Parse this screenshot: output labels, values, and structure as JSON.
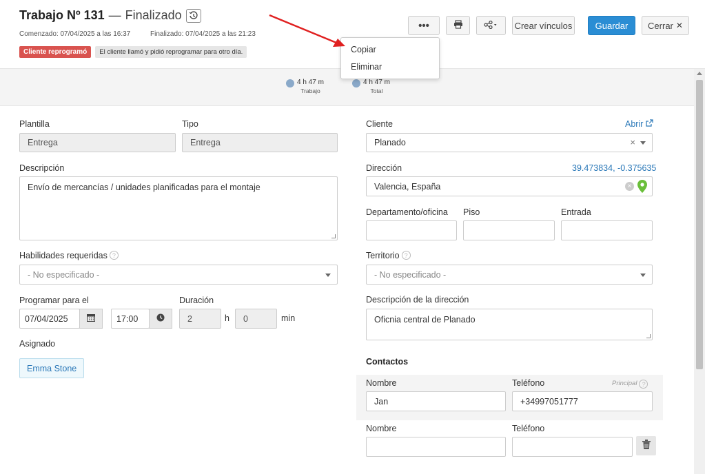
{
  "header": {
    "job_title": "Trabajo Nº 131",
    "separator": "—",
    "status": "Finalizado",
    "started": "Comenzado: 07/04/2025 a las 16:37",
    "finished": "Finalizado: 07/04/2025 a las 21:23",
    "tag_label": "Cliente reprogramó",
    "tag_note": "El cliente llamó y pidió reprogramar para otro día."
  },
  "toolbar": {
    "more_label": "•••",
    "create_links_label": "Crear vínculos",
    "save_label": "Guardar",
    "close_label": "Cerrar",
    "close_glyph": "✕"
  },
  "dropdown_menu": {
    "items": [
      "Copiar",
      "Eliminar"
    ]
  },
  "timers": {
    "work": {
      "value": "4 h 47 m",
      "label": "Trabajo"
    },
    "total": {
      "value": "4 h 47 m",
      "label": "Total"
    }
  },
  "form": {
    "template": {
      "label": "Plantilla",
      "value": "Entrega"
    },
    "type": {
      "label": "Tipo",
      "value": "Entrega"
    },
    "description": {
      "label": "Descripción",
      "value": "Envío de mercancías / unidades planificadas para el montaje"
    },
    "skills": {
      "label": "Habilidades requeridas",
      "value": "- No especificado -"
    },
    "schedule": {
      "label": "Programar para el",
      "date": "07/04/2025",
      "time": "17:00"
    },
    "duration": {
      "label": "Duración",
      "hours": "2",
      "hours_unit": "h",
      "minutes": "0",
      "minutes_unit": "min"
    },
    "assigned": {
      "label": "Asignado",
      "value": "Emma Stone"
    },
    "client": {
      "label": "Cliente",
      "open_link": "Abrir",
      "value": "Planado",
      "clear_glyph": "×"
    },
    "address": {
      "label": "Dirección",
      "coords": "39.473834, -0.375635",
      "value": "Valencia, España"
    },
    "department": {
      "label": "Departamento/oficina",
      "value": ""
    },
    "floor": {
      "label": "Piso",
      "value": ""
    },
    "entrance": {
      "label": "Entrada",
      "value": ""
    },
    "territory": {
      "label": "Territorio",
      "value": "- No especificado -"
    },
    "address_description": {
      "label": "Descripción de la dirección",
      "value": "Oficnia central de Planado"
    }
  },
  "contacts": {
    "title": "Contactos",
    "principal_label": "Principal",
    "rows": [
      {
        "name_label": "Nombre",
        "phone_label": "Teléfono",
        "name": "Jan",
        "phone": "+34997051777"
      },
      {
        "name_label": "Nombre",
        "phone_label": "Teléfono",
        "name": "",
        "phone": ""
      }
    ]
  },
  "help_glyph": "?",
  "colors": {
    "primary": "#2a8dd4",
    "tag_red": "#d9534f",
    "link": "#2a78b8",
    "pin": "#6abf3a",
    "annotation_arrow": "#e02020"
  },
  "icons": [
    "history-icon",
    "print-icon",
    "share-icon",
    "calendar-icon",
    "clock-icon",
    "external-link-icon",
    "map-pin-icon",
    "trash-icon",
    "play-icon"
  ]
}
